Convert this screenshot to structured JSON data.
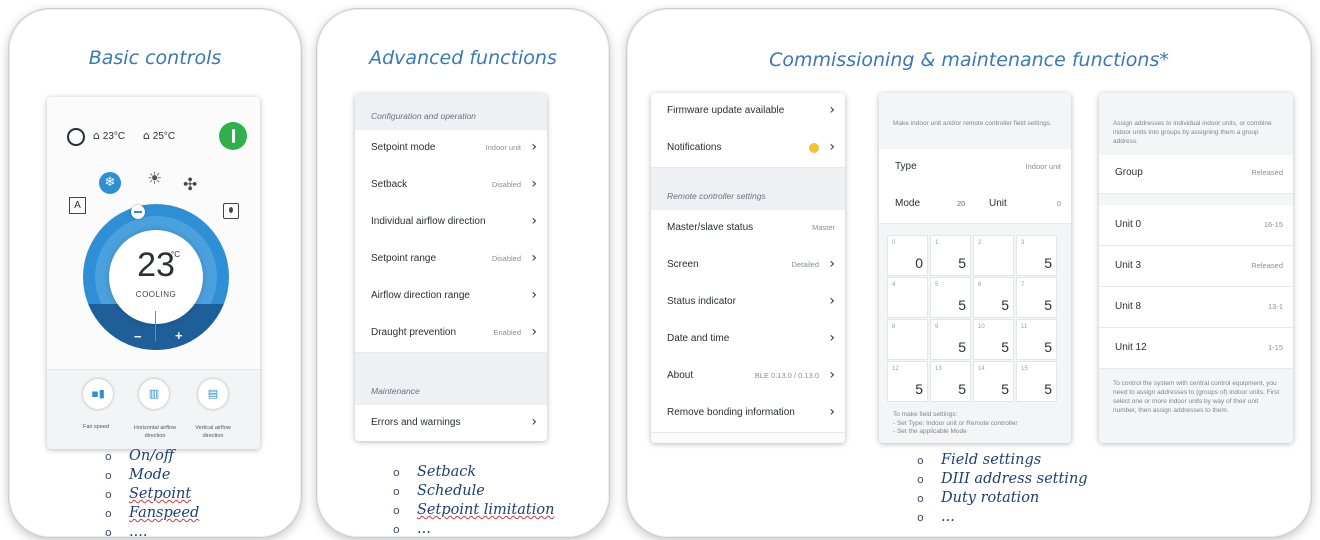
{
  "panels": {
    "basic": {
      "title": "Basic controls",
      "device": {
        "indoor_temp": "23°C",
        "outdoor_temp": "25°C",
        "setpoint": "23",
        "unit": "°C",
        "mode_text": "COOLING",
        "minus": "−",
        "plus": "+",
        "auto_label": "A",
        "controls": {
          "fan_speed": "Fan speed",
          "horizontal_airflow": "Horizontal airflow direction",
          "vertical_airflow": "Vertical airflow direction"
        }
      },
      "bullets": [
        {
          "text": "On/off",
          "underline": false
        },
        {
          "text": "Mode",
          "underline": false
        },
        {
          "text": "Setpoint",
          "underline": true
        },
        {
          "text": "Fanspeed",
          "underline": true
        },
        {
          "text": "....",
          "underline": false
        }
      ]
    },
    "advanced": {
      "title": "Advanced functions",
      "section1": "Configuration and operation",
      "rows": [
        {
          "label": "Setpoint mode",
          "value": "Indoor unit"
        },
        {
          "label": "Setback",
          "value": "Disabled"
        },
        {
          "label": "Individual airflow direction",
          "value": ""
        },
        {
          "label": "Setpoint range",
          "value": "Disabled"
        },
        {
          "label": "Airflow direction range",
          "value": ""
        },
        {
          "label": "Draught prevention",
          "value": "Enabled"
        }
      ],
      "section2": "Maintenance",
      "row_last": {
        "label": "Errors and warnings",
        "value": ""
      },
      "bullets": [
        {
          "text": "Setback",
          "underline": false
        },
        {
          "text": "Schedule",
          "underline": false
        },
        {
          "text": "Setpoint limitation",
          "underline": true
        },
        {
          "text": "...",
          "underline": false
        }
      ]
    },
    "commissioning": {
      "title": "Commissioning & maintenance functions*",
      "screen1": {
        "rows_top": [
          {
            "label": "Firmware update available",
            "value": ""
          },
          {
            "label": "Notifications",
            "value": ""
          }
        ],
        "section": "Remote controller settings",
        "rows": [
          {
            "label": "Master/slave status",
            "value": "Master",
            "chev": false
          },
          {
            "label": "Screen",
            "value": "Detailed",
            "chev": true
          },
          {
            "label": "Status indicator",
            "value": "",
            "chev": true
          },
          {
            "label": "Date and time",
            "value": "",
            "chev": true
          },
          {
            "label": "About",
            "value": "BLE 0.13.0 / 0.13.0",
            "chev": true
          },
          {
            "label": "Remove bonding information",
            "value": "",
            "chev": true
          }
        ]
      },
      "screen2": {
        "intro": "Make indoor unit and/or remote controller field settings.",
        "type_label": "Type",
        "type_value": "Indoor unit",
        "mode_label": "Mode",
        "mode_value": "20",
        "unit_label": "Unit",
        "unit_value": "0",
        "cells": [
          {
            "i": "0",
            "v": "0"
          },
          {
            "i": "1",
            "v": "5"
          },
          {
            "i": "2",
            "v": ""
          },
          {
            "i": "3",
            "v": "5"
          },
          {
            "i": "4",
            "v": ""
          },
          {
            "i": "5",
            "v": "5"
          },
          {
            "i": "6",
            "v": "5"
          },
          {
            "i": "7",
            "v": "5"
          },
          {
            "i": "8",
            "v": ""
          },
          {
            "i": "9",
            "v": "5"
          },
          {
            "i": "10",
            "v": "5"
          },
          {
            "i": "11",
            "v": "5"
          },
          {
            "i": "12",
            "v": "5"
          },
          {
            "i": "13",
            "v": "5"
          },
          {
            "i": "14",
            "v": "5"
          },
          {
            "i": "15",
            "v": "5"
          }
        ],
        "footer_title": "To make field settings:",
        "footer_lines": [
          "- Set Type: Indoor unit or Remote controller",
          "- Set the applicable Mode"
        ]
      },
      "screen3": {
        "intro": "Assign addresses to individual indoor units, or combine indoor units into groups by assigning them a group address.",
        "group_label": "Group",
        "group_value": "Released",
        "units": [
          {
            "label": "Unit 0",
            "value": "16-15"
          },
          {
            "label": "Unit 3",
            "value": "Released"
          },
          {
            "label": "Unit 8",
            "value": "13-1"
          },
          {
            "label": "Unit 12",
            "value": "1-15"
          }
        ],
        "footer": "To control the system with central control equipment, you need to assign addresses to (groups of) indoor units. First select one or more indoor units by way of their unit number, then assign addresses to them."
      },
      "bullets": [
        {
          "text": "Field settings",
          "underline": false
        },
        {
          "text": "DIII address setting",
          "underline": false
        },
        {
          "text": "Duty rotation",
          "underline": false
        },
        {
          "text": "...",
          "underline": false
        }
      ]
    }
  },
  "colors": {
    "title_blue": "#3a78b8",
    "dial_blue": "#2f8fd6",
    "power_green": "#2fb04a",
    "notification_yellow": "#f2c230"
  }
}
